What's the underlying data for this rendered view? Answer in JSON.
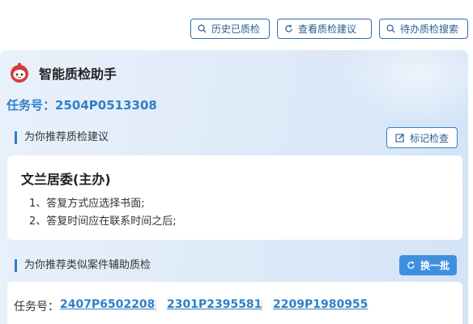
{
  "toolbar": {
    "history_label": "历史已质检",
    "view_suggestions_label": "查看质检建议",
    "pending_search_label": "待办质检搜索"
  },
  "assistant": {
    "title": "智能质检助手"
  },
  "task": {
    "label": "任务号：",
    "number": "2504P0513308"
  },
  "suggestions": {
    "section_title": "为你推荐质检建议",
    "mark_button_label": "标记检查",
    "card_title": "文兰居委(主办)",
    "items": [
      "1、答复方式应选择书面;",
      "2、答复时间应在联系时间之后;"
    ]
  },
  "similar": {
    "section_title": "为你推荐类似案件辅助质检",
    "swap_button_label": "换一批",
    "label": "任务号：",
    "tasks": [
      "2407P6502208",
      "2301P2395581",
      "2209P1980955"
    ]
  },
  "colors": {
    "accent": "#2f7fc7",
    "primary_button": "#3f8fe0"
  }
}
